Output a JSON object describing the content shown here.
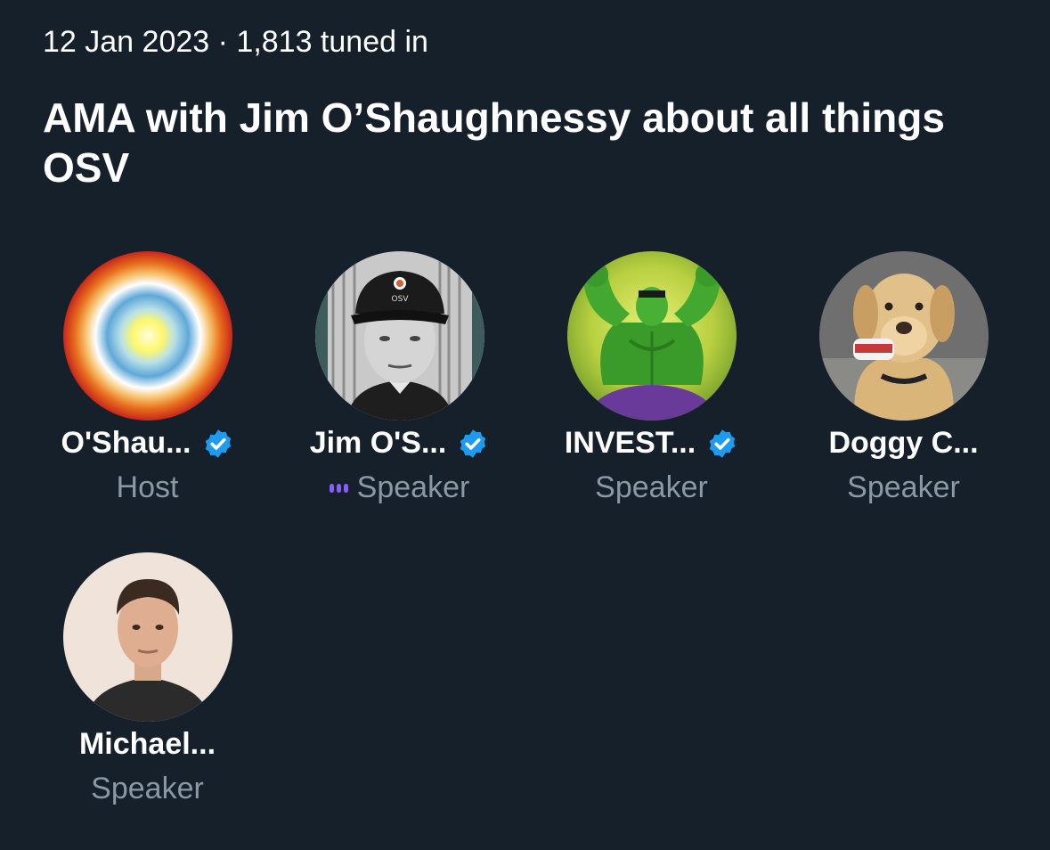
{
  "space": {
    "date": "12 Jan 2023",
    "separator": "·",
    "tuned_in": "1,813 tuned in",
    "title": "AMA with Jim O’Shaughnessy about all things OSV"
  },
  "participants": [
    {
      "name": "O'Shau...",
      "role": "Host",
      "verified": true,
      "speaking": false,
      "avatar": "gradient-circle-avatar"
    },
    {
      "name": "Jim O'S...",
      "role": "Speaker",
      "verified": true,
      "speaking": true,
      "avatar": "man-in-osv-cap-avatar"
    },
    {
      "name": "INVEST...",
      "role": "Speaker",
      "verified": true,
      "speaking": false,
      "avatar": "hulk-avatar"
    },
    {
      "name": "Doggy C...",
      "role": "Speaker",
      "verified": false,
      "speaking": false,
      "avatar": "labrador-dog-avatar"
    },
    {
      "name": "Michael...",
      "role": "Speaker",
      "verified": false,
      "speaking": false,
      "avatar": "man-portrait-avatar"
    }
  ],
  "colors": {
    "background": "#15202b",
    "secondary_text": "#8b98a5",
    "verified_blue": "#1d9bf0",
    "speaking_purple": "#8a5cf6"
  },
  "cap_text": "OSV"
}
